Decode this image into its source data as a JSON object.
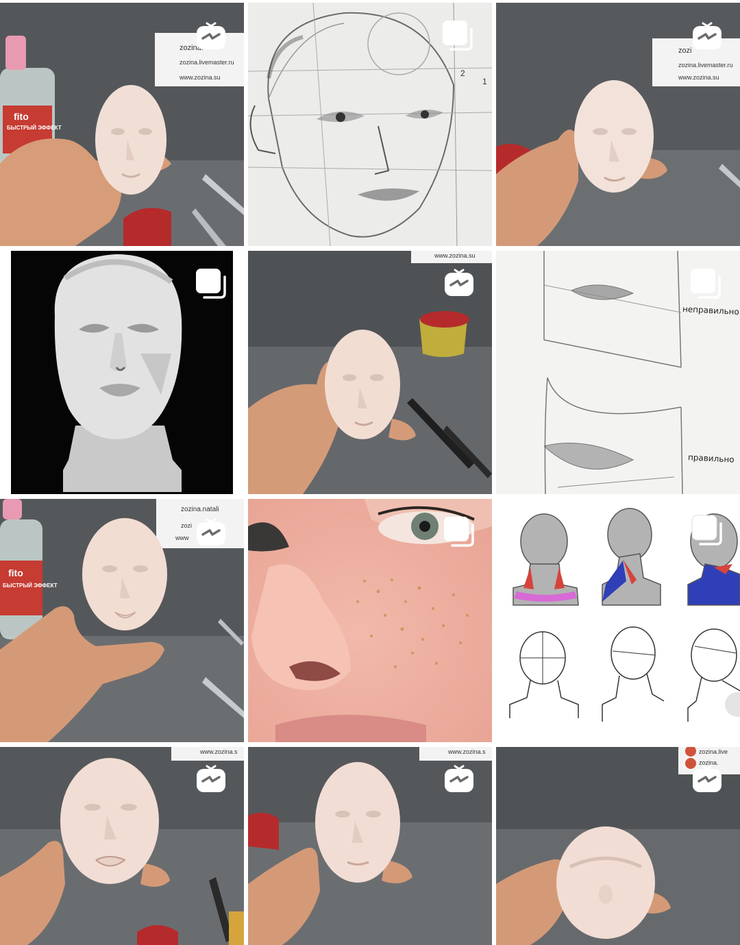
{
  "grid": {
    "columns": 3,
    "tiles": [
      {
        "kind": "video",
        "overlay": "igtv-icon",
        "label": {
          "line1": "zozina.",
          "line2": "zozina.livemaster.ru",
          "line3": "www.zozina.su"
        },
        "bottle": {
          "brand": "fito",
          "text": "БЫСТРЫЙ ЭФФЕКТ"
        }
      },
      {
        "kind": "carousel",
        "overlay": "carousel-icon",
        "notes": [
          "2",
          "1"
        ]
      },
      {
        "kind": "video",
        "overlay": "igtv-icon",
        "label": {
          "line1": "zozi",
          "line2": "zozina.livemaster.ru",
          "line3": "www.zozina.su"
        }
      },
      {
        "kind": "carousel",
        "overlay": "carousel-icon"
      },
      {
        "kind": "video",
        "overlay": "igtv-icon",
        "label": {
          "line3": "www.zozina.su"
        }
      },
      {
        "kind": "carousel",
        "overlay": "carousel-icon",
        "wrong": "неправильно",
        "right": "правильно"
      },
      {
        "kind": "video",
        "overlay": "igtv-icon",
        "label": {
          "line1": "zozina.natali",
          "line2": "zozi",
          "line3": "www"
        },
        "bottle": {
          "brand": "fito",
          "text": "БЫСТРЫЙ ЭФФЕКТ"
        }
      },
      {
        "kind": "carousel",
        "overlay": "carousel-icon"
      },
      {
        "kind": "carousel",
        "overlay": "carousel-icon"
      },
      {
        "kind": "video",
        "overlay": "igtv-icon",
        "label": {
          "line3": "www.zozina.s"
        }
      },
      {
        "kind": "video",
        "overlay": "igtv-icon",
        "label": {
          "line3": "www.zozina.s"
        }
      },
      {
        "kind": "video",
        "overlay": "igtv-icon",
        "label": {
          "line1": "zozina.live",
          "line2": "zozina."
        }
      }
    ]
  },
  "colors": {
    "background": "#ffffff",
    "overlay_icon": "#ffffff",
    "clay": "#f1dfd6",
    "backdrop": "#4b4d50"
  }
}
